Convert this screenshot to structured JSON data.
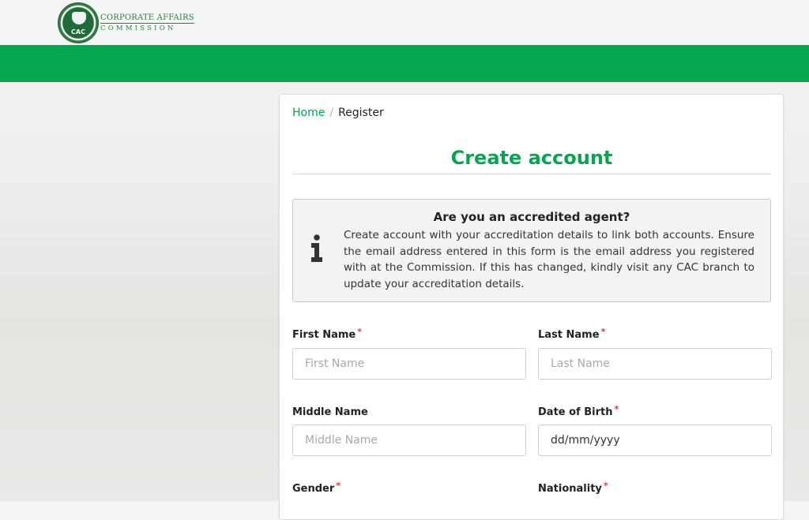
{
  "header": {
    "logo": {
      "seal_text": "CAC",
      "line1": "CORPORATE AFFAIRS",
      "line2": "COMMISSION",
      "accent": "#2e7d3f"
    },
    "bar_color": "#04a64f"
  },
  "breadcrumb": {
    "home": "Home",
    "separator": "/",
    "current": "Register"
  },
  "page_title": "Create account",
  "notice": {
    "icon": "info-icon",
    "title": "Are you an accredited agent?",
    "body": "Create account with your accreditation details to link both accounts. Ensure the email address entered in this form is the email address you registered with at the Commission. If this has changed, kindly visit any CAC branch to update your accreditation details."
  },
  "form": {
    "required_marker": "*",
    "first_name": {
      "label": "First Name",
      "placeholder": "First Name",
      "value": ""
    },
    "last_name": {
      "label": "Last Name",
      "placeholder": "Last Name",
      "value": ""
    },
    "middle_name": {
      "label": "Middle Name",
      "placeholder": "Middle Name",
      "value": ""
    },
    "dob": {
      "label": "Date of Birth",
      "value": "dd/mm/yyyy"
    },
    "gender": {
      "label": "Gender"
    },
    "nationality": {
      "label": "Nationality"
    }
  },
  "colors": {
    "brand_green": "#04a64f",
    "required_red": "#e53935"
  }
}
